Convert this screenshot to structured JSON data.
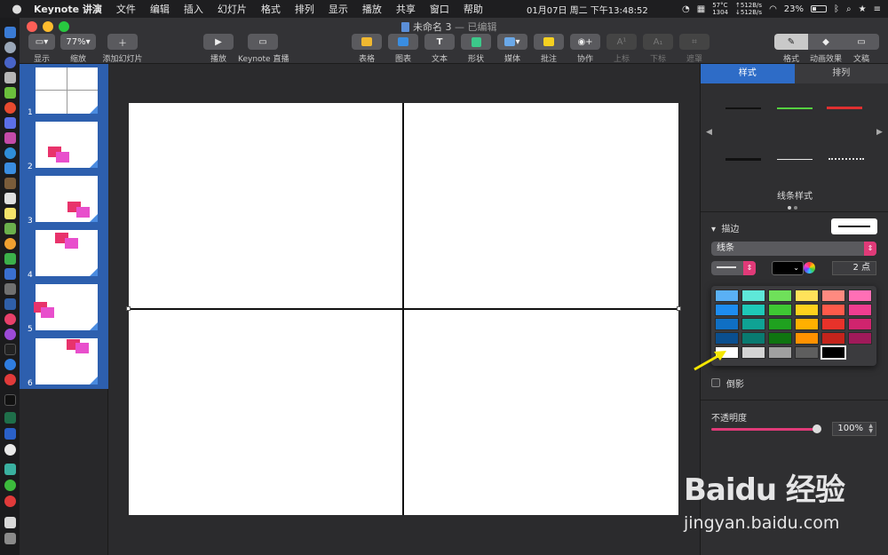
{
  "menubar": {
    "app": "Keynote 讲演",
    "items": [
      "文件",
      "编辑",
      "插入",
      "幻灯片",
      "格式",
      "排列",
      "显示",
      "播放",
      "共享",
      "窗口",
      "帮助"
    ],
    "temp": "57°C",
    "fan": "1304",
    "net_up": "↑512B/s",
    "net_down": "↓512B/s",
    "clock": "01月07日 周二 下午13:48:52",
    "battery": "23%"
  },
  "window": {
    "title": "未命名 3",
    "subtitle": "— 已编辑"
  },
  "toolbar": {
    "view": {
      "label": "显示",
      "icon": "sidebar-icon"
    },
    "zoom": {
      "label": "缩放",
      "value": "77%"
    },
    "add_slide": {
      "label": "添加幻灯片",
      "icon": "plus-icon"
    },
    "play": {
      "label": "播放",
      "icon": "play-icon"
    },
    "keynote_live": {
      "label": "Keynote 直播",
      "icon": "screen-icon"
    },
    "table": {
      "label": "表格",
      "icon": "table-icon"
    },
    "chart": {
      "label": "图表",
      "icon": "chart-icon"
    },
    "text": {
      "label": "文本",
      "icon": "text-icon"
    },
    "shape": {
      "label": "形状",
      "icon": "shape-icon"
    },
    "media": {
      "label": "媒体",
      "icon": "media-icon"
    },
    "comment": {
      "label": "批注",
      "icon": "comment-icon"
    },
    "collaborate": {
      "label": "协作",
      "icon": "collaborate-icon"
    },
    "superscript": {
      "label": "上标"
    },
    "subscript": {
      "label": "下标"
    },
    "mask": {
      "label": "遮罩"
    },
    "format": {
      "label": "格式"
    },
    "animate": {
      "label": "动画效果"
    },
    "document": {
      "label": "文稿"
    }
  },
  "navigator": {
    "slides": [
      {
        "number": "1"
      },
      {
        "number": "2"
      },
      {
        "number": "3"
      },
      {
        "number": "4"
      },
      {
        "number": "5"
      },
      {
        "number": "6"
      }
    ]
  },
  "inspector": {
    "tabs": [
      "样式",
      "排列"
    ],
    "line_styles_caption": "线条样式",
    "stroke_section": "描边",
    "stroke_type": "线条",
    "width_value": "2 点",
    "shadow_label": "倒影",
    "opacity_label": "不透明度",
    "opacity_value": "100%",
    "opacity_level": 1.0
  },
  "color_popover": {
    "rows": [
      [
        "#5ab0f5",
        "#5ee8d8",
        "#6fe05a",
        "#ffe25a",
        "#ff8a80",
        "#ff6fb5"
      ],
      [
        "#1d8cf0",
        "#1ec9b8",
        "#3ec833",
        "#ffd21c",
        "#ff5a4a",
        "#f03d90"
      ],
      [
        "#0f6fc4",
        "#0fa294",
        "#1fa11f",
        "#ffb000",
        "#e8322a",
        "#d0246e"
      ],
      [
        "#0a4f8f",
        "#097a70",
        "#0f7410",
        "#ff9200",
        "#c4241c",
        "#a01a5a"
      ],
      [
        "#ffffff",
        "#d4d4d4",
        "#a0a0a0",
        "#5e5e5e",
        "#000000",
        ""
      ]
    ],
    "selected": "#000000"
  },
  "watermark": {
    "brand": "Baidu 经验",
    "url": "jingyan.baidu.com"
  }
}
